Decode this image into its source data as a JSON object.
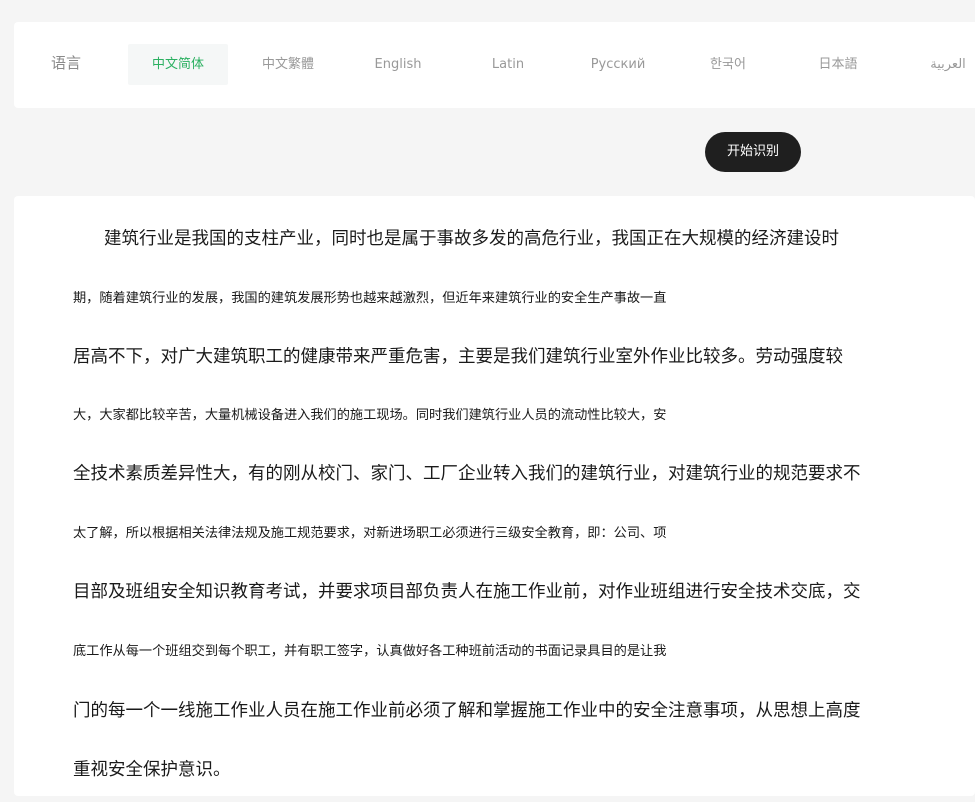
{
  "language_bar": {
    "label": "语言",
    "options": [
      {
        "label": "中文简体",
        "active": true
      },
      {
        "label": "中文繁體",
        "active": false
      },
      {
        "label": "English",
        "active": false
      },
      {
        "label": "Latin",
        "active": false
      },
      {
        "label": "Русский",
        "active": false
      },
      {
        "label": "한국어",
        "active": false
      },
      {
        "label": "日本語",
        "active": false
      },
      {
        "label": "العربية",
        "active": false
      }
    ]
  },
  "actions": {
    "start_label": "开始识别"
  },
  "result": {
    "lines": [
      "建筑行业是我国的支柱产业，同时也是属于事故多发的高危行业，我国正在大规模的经济建设时",
      "期，随着建筑行业的发展，我国的建筑发展形势也越来越激烈，但近年来建筑行业的安全生产事故一直",
      "居高不下，对广大建筑职工的健康带来严重危害，主要是我们建筑行业室外作业比较多。劳动强度较",
      "大，大家都比较辛苦，大量机械设备进入我们的施工现场。同时我们建筑行业人员的流动性比较大，安",
      "全技术素质差异性大，有的刚从校门、家门、工厂企业转入我们的建筑行业，对建筑行业的规范要求不",
      "太了解，所以根据相关法律法规及施工规范要求，对新进场职工必须进行三级安全教育，即：公司、项",
      "目部及班组安全知识教育考试，并要求项目部负责人在施工作业前，对作业班组进行安全技术交底，交",
      "底工作从每一个班组交到每个职工，并有职工签字，认真做好各工种班前活动的书面记录具目的是让我",
      "门的每一个一线施工作业人员在施工作业前必须了解和掌握施工作业中的安全注意事项，从思想上高度",
      "重视安全保护意识。"
    ]
  },
  "colors": {
    "accent": "#2bb061",
    "button_bg": "#1f1f1f",
    "page_bg": "#f5f5f5"
  }
}
